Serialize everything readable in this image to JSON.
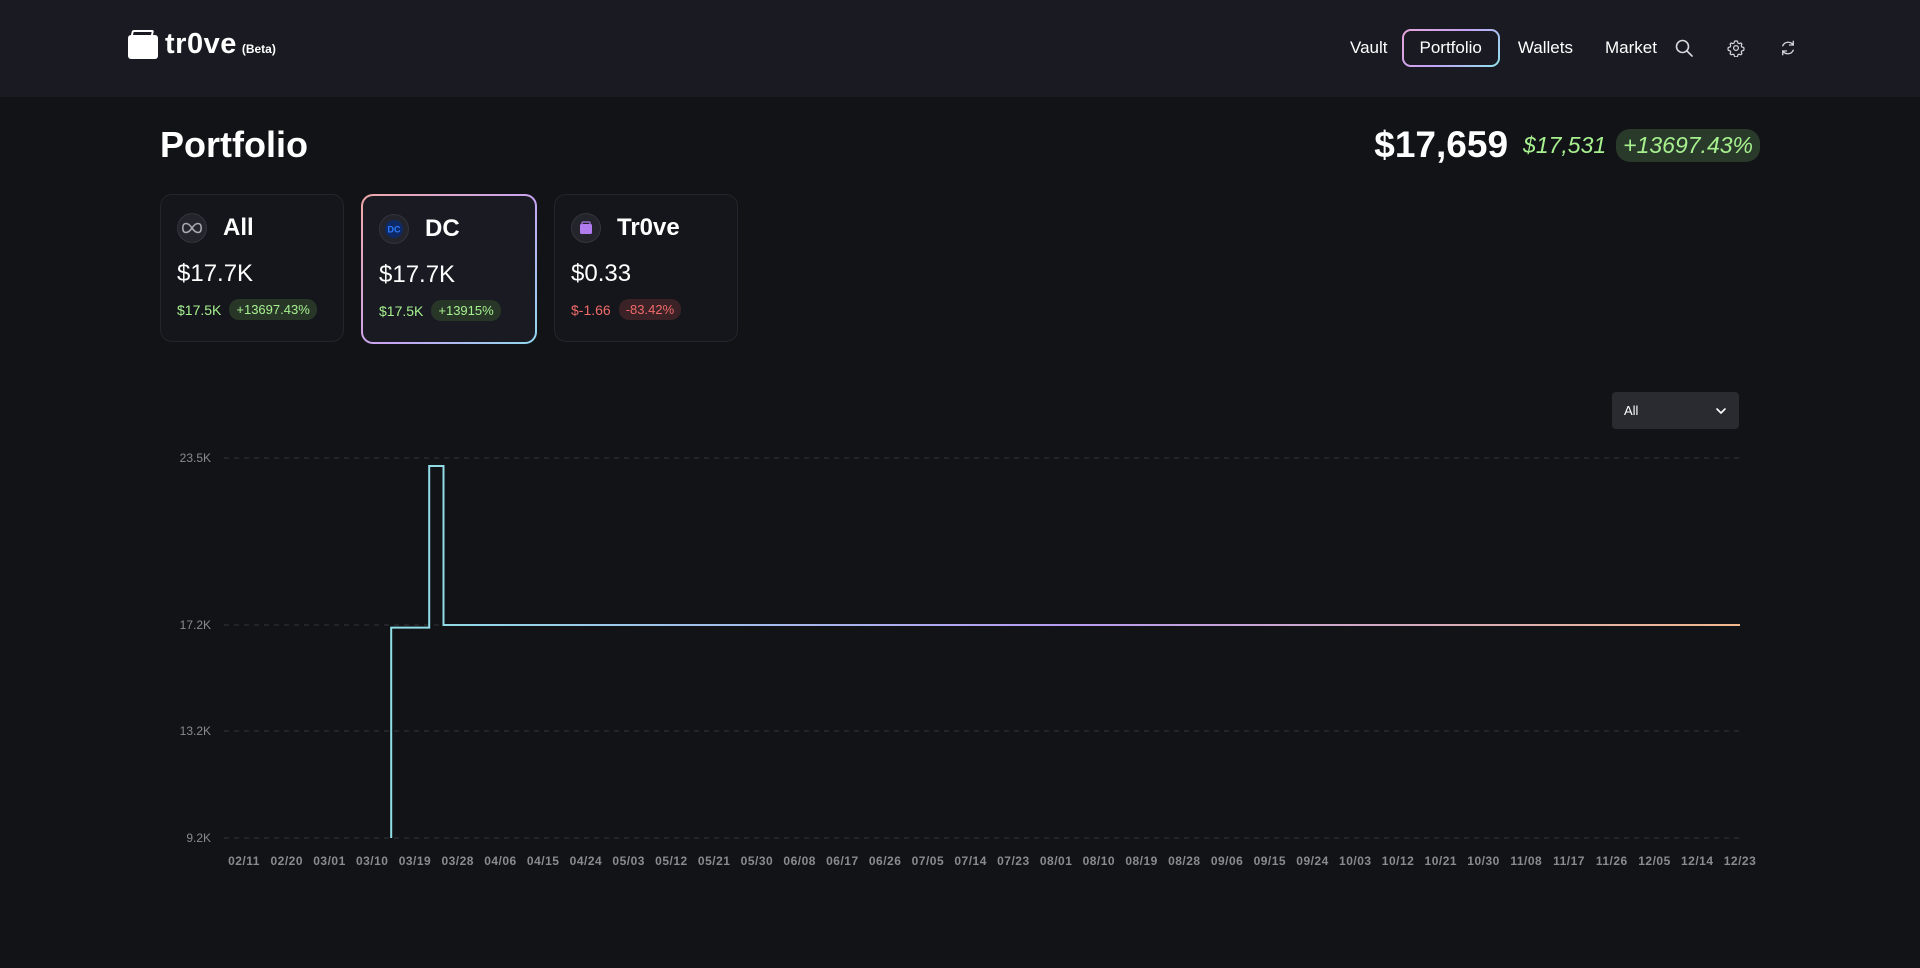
{
  "brand": {
    "name": "tr0ve",
    "tag": "(Beta)"
  },
  "nav": {
    "items": [
      {
        "label": "Vault",
        "active": false
      },
      {
        "label": "Portfolio",
        "active": true
      },
      {
        "label": "Wallets",
        "active": false
      },
      {
        "label": "Market",
        "active": false
      }
    ],
    "icons": [
      "search-icon",
      "gear-icon",
      "refresh-icon"
    ]
  },
  "header": {
    "title": "Portfolio",
    "total": "$17,659",
    "cost": "$17,531",
    "change": "+13697.43%"
  },
  "cards": [
    {
      "name": "All",
      "icon": "infinity-icon",
      "value": "$17.7K",
      "cost": "$17.5K",
      "change": "+13697.43%",
      "trend": "positive",
      "selected": false
    },
    {
      "name": "DC",
      "icon": "dc-logo-icon",
      "value": "$17.7K",
      "cost": "$17.5K",
      "change": "+13915%",
      "trend": "positive",
      "selected": true
    },
    {
      "name": "Tr0ve",
      "icon": "trove-wallet-icon",
      "value": "$0.33",
      "cost": "$-1.66",
      "change": "-83.42%",
      "trend": "negative",
      "selected": false
    }
  ],
  "range_select": {
    "value": "All"
  },
  "colors": {
    "positive": "#a6f08f",
    "negative": "#f06a6a",
    "line_start": "#8ee0e6",
    "line_mid": "#b79cf2",
    "line_end": "#f2b98d"
  },
  "chart_data": {
    "type": "line",
    "title": "",
    "xlabel": "",
    "ylabel": "",
    "y_ticks": [
      "9.2K",
      "13.2K",
      "17.2K",
      "23.5K"
    ],
    "y_tick_values": [
      9200,
      13200,
      17200,
      23500
    ],
    "x_ticks": [
      "02/11",
      "02/20",
      "03/01",
      "03/10",
      "03/19",
      "03/28",
      "04/06",
      "04/15",
      "04/24",
      "05/03",
      "05/12",
      "05/21",
      "05/30",
      "06/08",
      "06/17",
      "06/26",
      "07/05",
      "07/14",
      "07/23",
      "08/01",
      "08/10",
      "08/19",
      "08/28",
      "09/06",
      "09/15",
      "09/24",
      "10/03",
      "10/12",
      "10/21",
      "10/30",
      "11/08",
      "11/17",
      "11/26",
      "12/05",
      "12/14",
      "12/23"
    ],
    "grid": true,
    "series": [
      {
        "x": [
          "03/14",
          "03/14",
          "03/22",
          "03/22",
          "03/25",
          "03/25",
          "12/23"
        ],
        "y": [
          9200,
          17100,
          17100,
          23200,
          23200,
          17200,
          17200
        ]
      }
    ]
  }
}
